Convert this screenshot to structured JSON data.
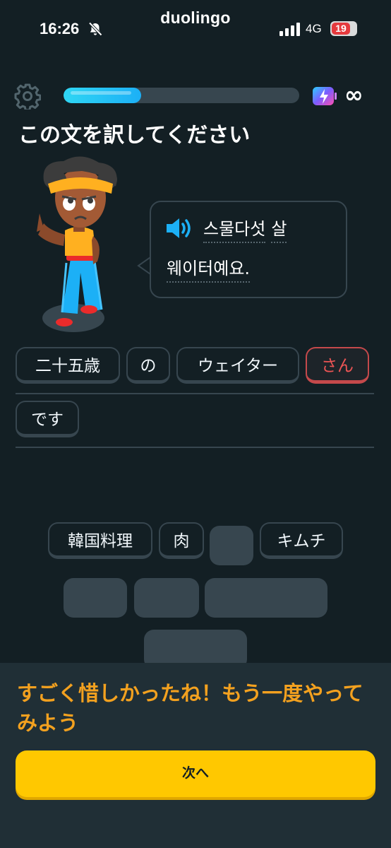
{
  "status_bar": {
    "time": "16:26",
    "brand": "duolingo",
    "network": "4G",
    "battery": "19"
  },
  "progress": {
    "fraction": 0.33
  },
  "energy": {
    "infinite_symbol": "∞"
  },
  "prompt": {
    "title": "この文を訳してください"
  },
  "speech": {
    "line1_words": [
      "스물다섯",
      "살"
    ],
    "line2_words": [
      "웨이터예요."
    ]
  },
  "answer": {
    "tiles": [
      "二十五歳",
      "の",
      "ウェイター",
      "さん",
      "です"
    ],
    "wrong_tile": "さん"
  },
  "word_bank": {
    "tiles": [
      "韓国料理",
      "肉",
      "キムチ"
    ]
  },
  "feedback": {
    "message": "すごく惜しかったね！もう一度やってみよう",
    "next_button": "次へ"
  },
  "colors": {
    "background": "#131f24",
    "progress": "#1cb0f6",
    "feedback_text": "#f3a11f",
    "button": "#ffc800",
    "wrong": "#ee5555"
  }
}
